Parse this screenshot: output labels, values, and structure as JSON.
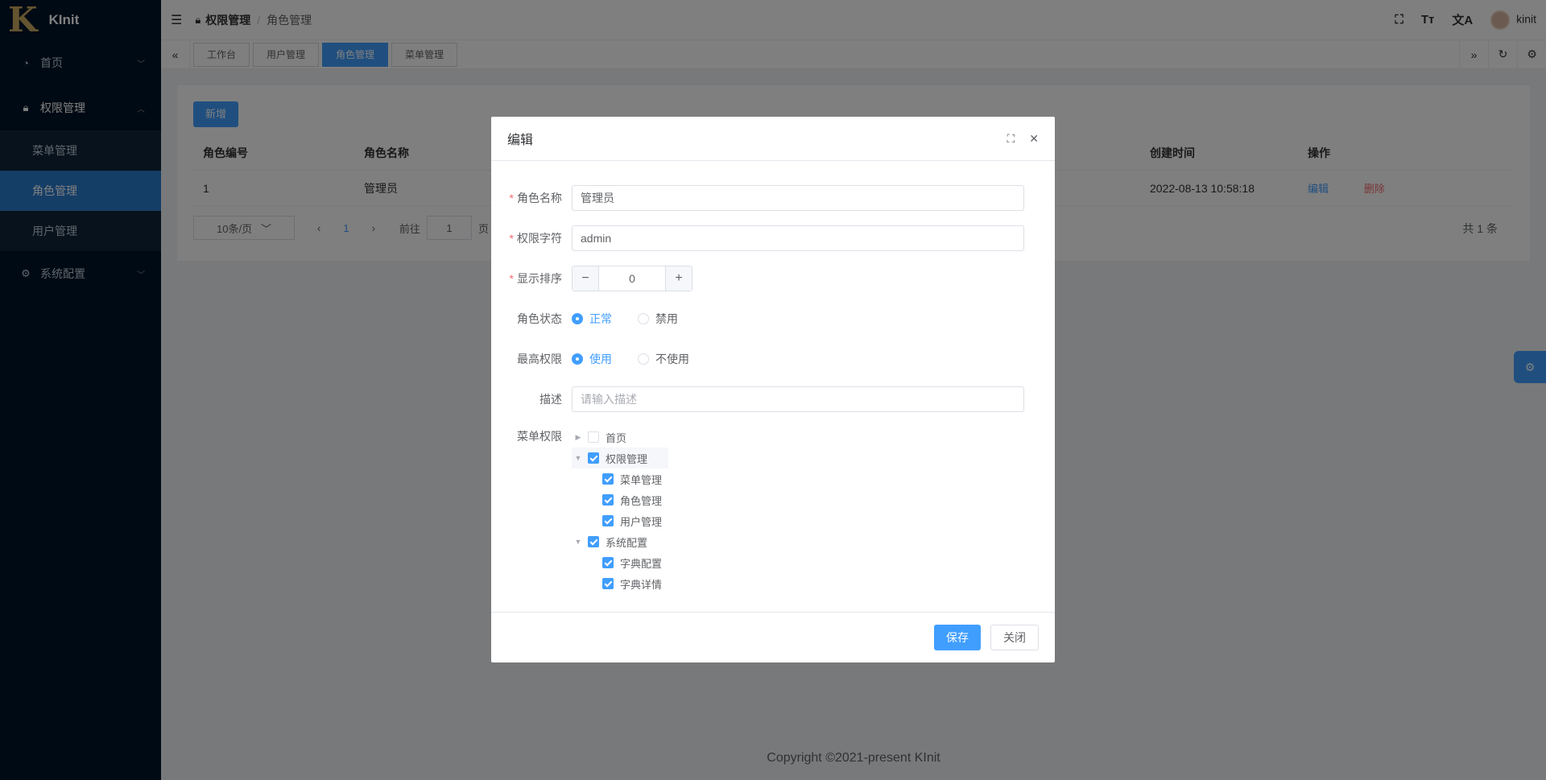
{
  "app": {
    "logo_letter": "K",
    "name": "KInit"
  },
  "sidebar": {
    "items": [
      {
        "label": "首页",
        "icon": "dashboard-icon"
      },
      {
        "label": "权限管理",
        "icon": "lock-icon"
      },
      {
        "label": "系统配置",
        "icon": "gear-icon"
      }
    ],
    "subitems": [
      "菜单管理",
      "角色管理",
      "用户管理"
    ]
  },
  "header": {
    "breadcrumb": [
      "权限管理",
      "角色管理"
    ],
    "sep": "/",
    "username": "kinit"
  },
  "tabs": [
    "工作台",
    "用户管理",
    "角色管理",
    "菜单管理"
  ],
  "main": {
    "add_label": "新增",
    "columns": [
      "角色编号",
      "角色名称",
      "创建时间",
      "操作"
    ],
    "rows": [
      {
        "id": "1",
        "name": "管理员",
        "created": "2022-08-13 10:58:18",
        "edit": "编辑",
        "delete": "删除"
      }
    ],
    "pager": {
      "size": "10条/页",
      "page": "1",
      "goto": "前往",
      "goto_value": "1",
      "goto_suffix": "页",
      "total": "共 1 条"
    },
    "footer": "Copyright ©2021-present KInit"
  },
  "dialog": {
    "title": "编辑",
    "fields": {
      "name_label": "角色名称",
      "name_value": "管理员",
      "key_label": "权限字符",
      "key_value": "admin",
      "order_label": "显示排序",
      "order_value": "0",
      "status_label": "角色状态",
      "status_on": "正常",
      "status_off": "禁用",
      "admin_label": "最高权限",
      "admin_on": "使用",
      "admin_off": "不使用",
      "desc_label": "描述",
      "desc_placeholder": "请输入描述",
      "menu_label": "菜单权限"
    },
    "tree": [
      {
        "label": "首页",
        "checked": false,
        "level": 0,
        "caret": "right"
      },
      {
        "label": "权限管理",
        "checked": true,
        "level": 0,
        "caret": "down"
      },
      {
        "label": "菜单管理",
        "checked": true,
        "level": 1
      },
      {
        "label": "角色管理",
        "checked": true,
        "level": 1
      },
      {
        "label": "用户管理",
        "checked": true,
        "level": 1
      },
      {
        "label": "系统配置",
        "checked": true,
        "level": 0,
        "caret": "down"
      },
      {
        "label": "字典配置",
        "checked": true,
        "level": 1
      },
      {
        "label": "字典详情",
        "checked": true,
        "level": 1
      }
    ],
    "save_label": "保存",
    "close_label": "关闭"
  }
}
